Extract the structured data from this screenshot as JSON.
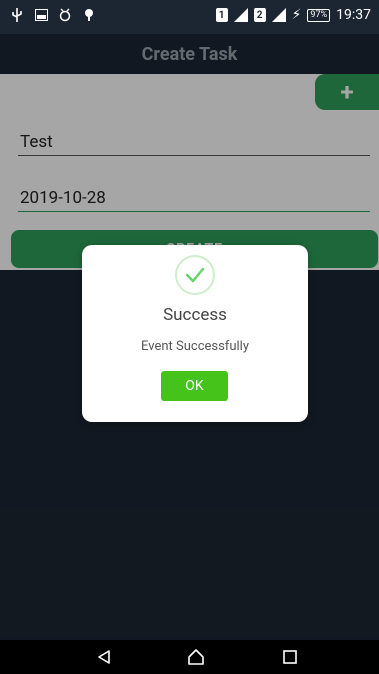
{
  "status_bar": {
    "left_icons": [
      "usb-icon",
      "image-icon",
      "alarm-icon",
      "notification-icon"
    ],
    "sim1": "1",
    "sim2": "2",
    "battery": "97%",
    "time": "19:37"
  },
  "app_bar": {
    "title": "Create Task"
  },
  "form": {
    "fab_label": "+",
    "task_name": "Test",
    "task_date": "2019-10-28",
    "create_label": "CREATE"
  },
  "dialog": {
    "title": "Success",
    "message": "Event Successfully",
    "ok_label": "OK",
    "icon": "check-icon"
  },
  "colors": {
    "dark": "#1c2633",
    "primary": "#2e9e5b",
    "ok": "#45c31b",
    "success_ring": "#cfeccd"
  }
}
